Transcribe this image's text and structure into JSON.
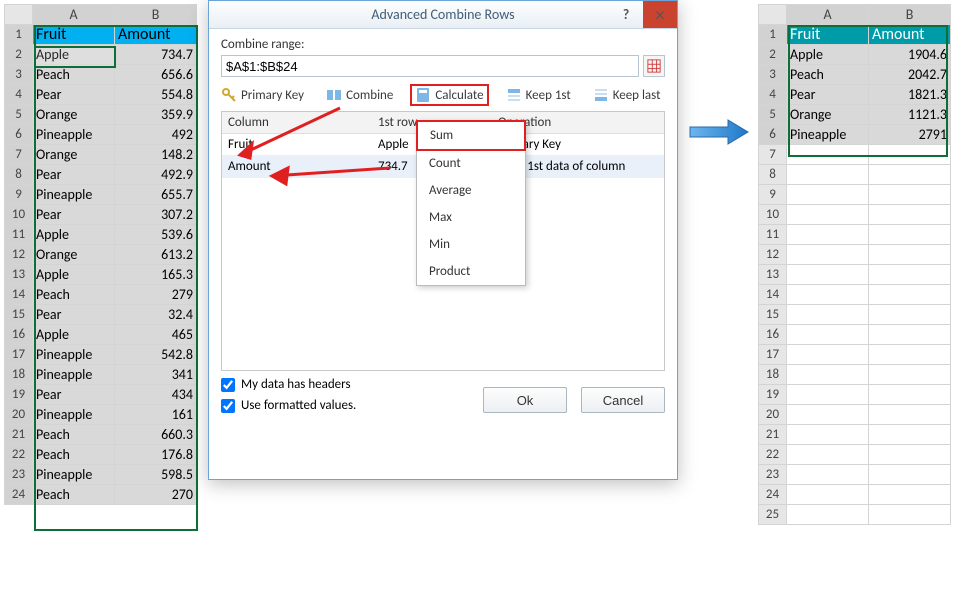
{
  "sheet_left": {
    "cols": [
      "A",
      "B"
    ],
    "headers": [
      "Fruit",
      "Amount"
    ],
    "rows": [
      [
        "Apple",
        "734.7"
      ],
      [
        "Peach",
        "656.6"
      ],
      [
        "Pear",
        "554.8"
      ],
      [
        "Orange",
        "359.9"
      ],
      [
        "Pineapple",
        "492"
      ],
      [
        "Orange",
        "148.2"
      ],
      [
        "Pear",
        "492.9"
      ],
      [
        "Pineapple",
        "655.7"
      ],
      [
        "Pear",
        "307.2"
      ],
      [
        "Apple",
        "539.6"
      ],
      [
        "Orange",
        "613.2"
      ],
      [
        "Apple",
        "165.3"
      ],
      [
        "Peach",
        "279"
      ],
      [
        "Pear",
        "32.4"
      ],
      [
        "Apple",
        "465"
      ],
      [
        "Pineapple",
        "542.8"
      ],
      [
        "Pineapple",
        "341"
      ],
      [
        "Pear",
        "434"
      ],
      [
        "Pineapple",
        "161"
      ],
      [
        "Peach",
        "660.3"
      ],
      [
        "Peach",
        "176.8"
      ],
      [
        "Pineapple",
        "598.5"
      ],
      [
        "Peach",
        "270"
      ]
    ]
  },
  "sheet_right": {
    "cols": [
      "A",
      "B"
    ],
    "headers": [
      "Fruit",
      "Amount"
    ],
    "rows": [
      [
        "Apple",
        "1904.6"
      ],
      [
        "Peach",
        "2042.7"
      ],
      [
        "Pear",
        "1821.3"
      ],
      [
        "Orange",
        "1121.3"
      ],
      [
        "Pineapple",
        "2791"
      ]
    ],
    "empty_to": 25
  },
  "dialog": {
    "title": "Advanced Combine Rows",
    "combine_range_label": "Combine range:",
    "range_value": "$A$1:$B$24",
    "toolbar": {
      "primary": "Primary Key",
      "combine": "Combine",
      "calculate": "Calculate",
      "keep1": "Keep 1st",
      "keeplast": "Keep last"
    },
    "col_headers": {
      "c": "Column",
      "r": "1st row",
      "o": "Operation"
    },
    "col_rows": [
      {
        "c": "Fruit",
        "r": "Apple",
        "o": "Primary Key"
      },
      {
        "c": "Amount",
        "r": "734.7",
        "o": "Keep 1st data of column"
      }
    ],
    "dropdown": [
      "Sum",
      "Count",
      "Average",
      "Max",
      "Min",
      "Product"
    ],
    "chk1": "My data has headers",
    "chk2": "Use formatted values.",
    "ok": "Ok",
    "cancel": "Cancel"
  }
}
